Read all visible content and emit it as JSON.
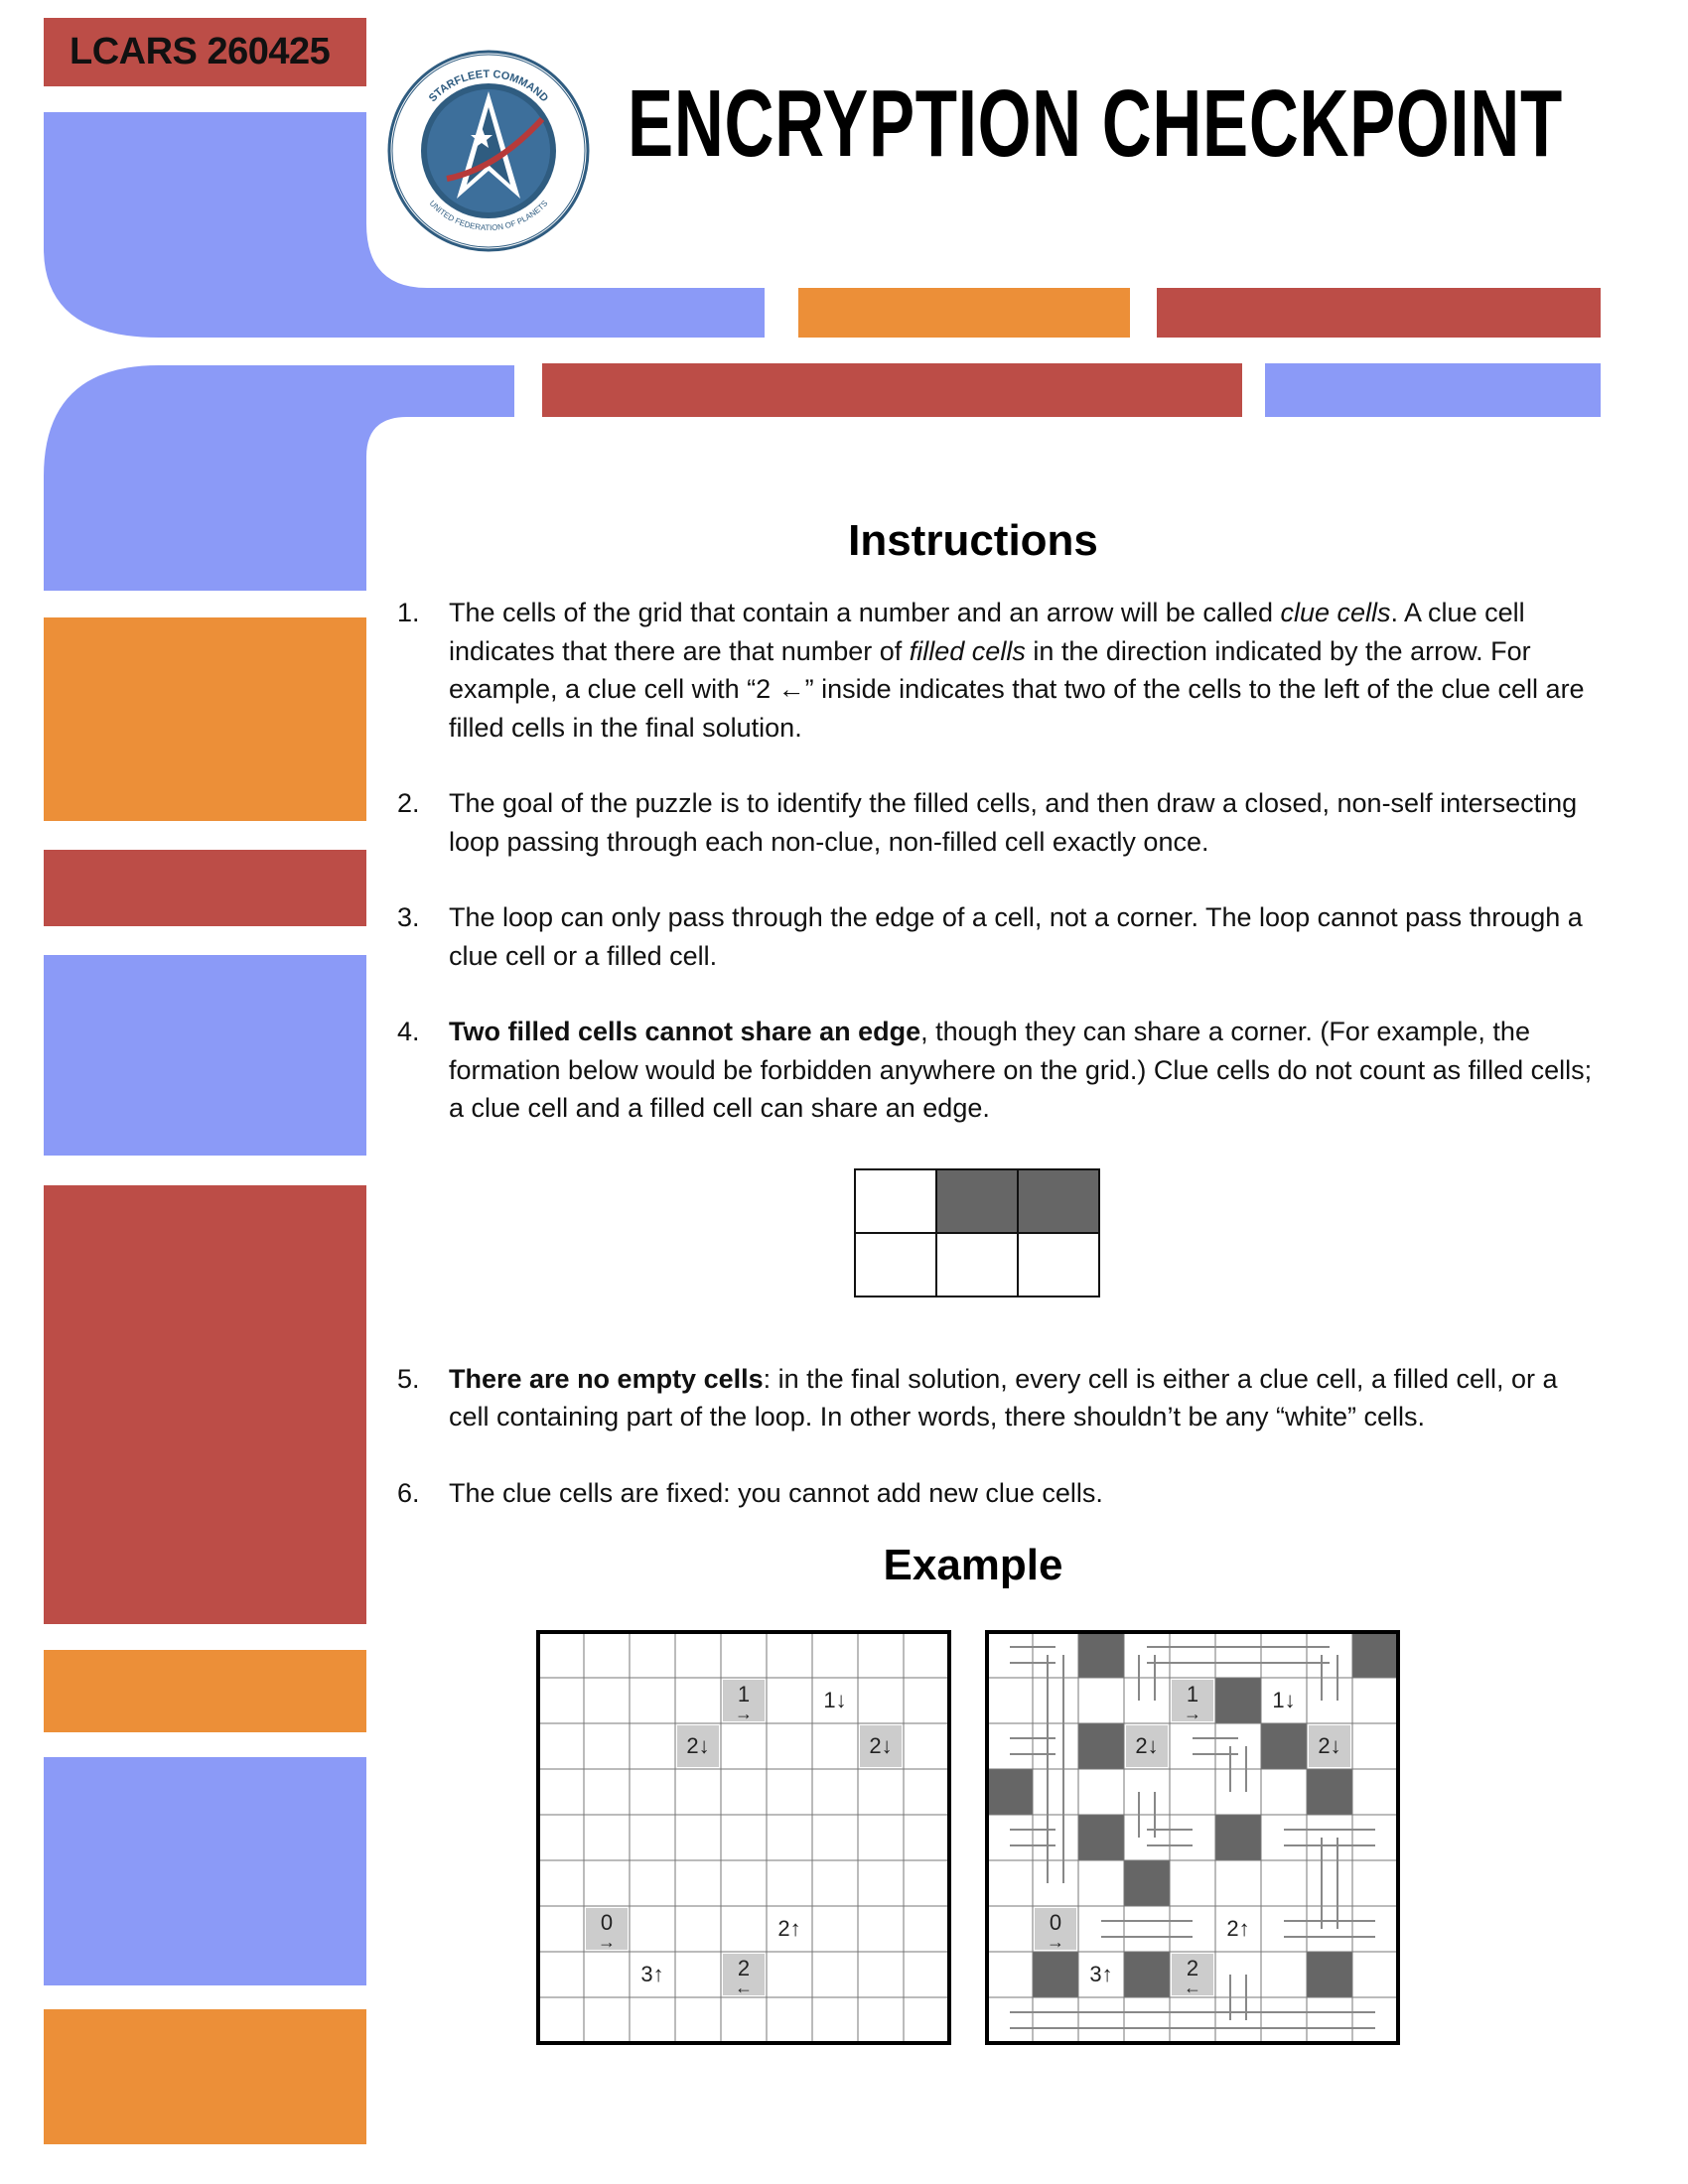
{
  "header": {
    "tag_label": "LCARS 260425",
    "title": "ENCRYPTION CHECKPOINT",
    "emblem": {
      "top_text": "STARFLEET COMMAND",
      "bottom_text": "UNITED FEDERATION OF PLANETS",
      "icon": "starfleet-delta-icon"
    }
  },
  "colors": {
    "blue": "#8b9af7",
    "orange": "#ec8f38",
    "red": "#bc4d47",
    "filled": "#666666",
    "clue": "#cccccc"
  },
  "instructions": {
    "heading": "Instructions",
    "items": [
      {
        "num": "1.",
        "parts": [
          {
            "t": "The cells of the grid that contain a number and an arrow will be called "
          },
          {
            "t": "clue cells",
            "style": "italic"
          },
          {
            "t": ". A clue cell indicates that there are that number of "
          },
          {
            "t": "filled cells",
            "style": "italic"
          },
          {
            "t": " in the direction indicated by the arrow. For example, a clue cell with “2 ←” inside indicates that two of the cells to the left of the clue cell are filled cells in the final solution."
          }
        ]
      },
      {
        "num": "2.",
        "parts": [
          {
            "t": "The goal of the puzzle is to identify the filled cells, and then draw a closed, non-self intersecting loop passing through each non-clue, non-filled cell exactly once."
          }
        ]
      },
      {
        "num": "3.",
        "parts": [
          {
            "t": "The loop can only pass through the edge of a cell, not a corner. The loop cannot pass through a clue cell or a filled cell."
          }
        ]
      },
      {
        "num": "4.",
        "parts": [
          {
            "t": "Two filled cells cannot share an edge",
            "style": "bold"
          },
          {
            "t": ", though they can share a corner. (For example, the formation below would be forbidden anywhere on the grid.) Clue cells do not count as filled cells; a clue cell and a filled cell can share an edge."
          }
        ]
      },
      {
        "num": "5.",
        "parts": [
          {
            "t": "There are no empty cells",
            "style": "bold"
          },
          {
            "t": ": in the final solution, every cell is either a clue cell, a filled cell, or a cell containing part of the loop. In other words, there shouldn’t be any “white” cells."
          }
        ]
      },
      {
        "num": "6.",
        "parts": [
          {
            "t": "The clue cells are fixed: you cannot add new clue cells."
          }
        ]
      }
    ],
    "forbidden_example": {
      "rows": [
        [
          false,
          true,
          true
        ],
        [
          false,
          false,
          false
        ]
      ]
    }
  },
  "example": {
    "heading": "Example",
    "grid_size": 9,
    "clues": [
      {
        "row": 1,
        "col": 4,
        "num": "1",
        "arrow": "→",
        "style": "stacked",
        "shaded": true
      },
      {
        "row": 1,
        "col": 6,
        "num": "1",
        "arrow": "↓",
        "style": "inline",
        "shaded": false
      },
      {
        "row": 2,
        "col": 3,
        "num": "2",
        "arrow": "↓",
        "style": "inline",
        "shaded": true
      },
      {
        "row": 2,
        "col": 7,
        "num": "2",
        "arrow": "↓",
        "style": "inline",
        "shaded": true
      },
      {
        "row": 6,
        "col": 1,
        "num": "0",
        "arrow": "→",
        "style": "stacked",
        "shaded": true
      },
      {
        "row": 6,
        "col": 5,
        "num": "2",
        "arrow": "↑",
        "style": "inline",
        "shaded": false
      },
      {
        "row": 7,
        "col": 2,
        "num": "3",
        "arrow": "↑",
        "style": "inline",
        "shaded": false
      },
      {
        "row": 7,
        "col": 4,
        "num": "2",
        "arrow": "←",
        "style": "stacked",
        "shaded": true
      }
    ],
    "solution_filled": [
      [
        0,
        2
      ],
      [
        0,
        8
      ],
      [
        1,
        5
      ],
      [
        2,
        2
      ],
      [
        2,
        6
      ],
      [
        3,
        0
      ],
      [
        3,
        7
      ],
      [
        4,
        2
      ],
      [
        4,
        5
      ],
      [
        5,
        3
      ],
      [
        7,
        1
      ],
      [
        7,
        3
      ],
      [
        7,
        7
      ]
    ]
  }
}
